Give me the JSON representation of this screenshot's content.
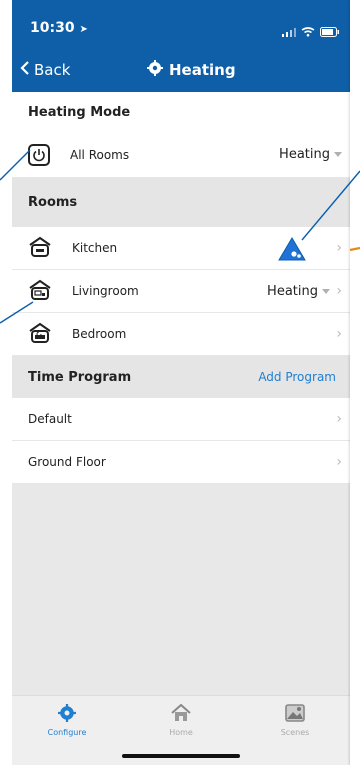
{
  "status_bar": {
    "time": "10:30"
  },
  "nav": {
    "back_label": "Back",
    "title": "Heating",
    "title_icon": "gear-icon"
  },
  "heating_mode": {
    "title": "Heating Mode",
    "row_label": "All Rooms",
    "row_value": "Heating",
    "icon": "power-icon"
  },
  "rooms": {
    "title": "Rooms",
    "items": [
      {
        "label": "Kitchen",
        "icon": "kitchen-icon",
        "value": ""
      },
      {
        "label": "Livingroom",
        "icon": "livingroom-icon",
        "value": "Heating"
      },
      {
        "label": "Bedroom",
        "icon": "bedroom-icon",
        "value": ""
      }
    ]
  },
  "time_program": {
    "title": "Time Program",
    "add_label": "Add Program",
    "items": [
      {
        "label": "Default"
      },
      {
        "label": "Ground Floor"
      }
    ]
  },
  "tabbar": {
    "items": [
      {
        "label": "Configure",
        "icon": "gear-icon",
        "active": true
      },
      {
        "label": "Home",
        "icon": "home-icon",
        "active": false
      },
      {
        "label": "Scenes",
        "icon": "image-icon",
        "active": false
      }
    ]
  },
  "colors": {
    "header": "#0e5fa8",
    "accent": "#1f7fd1",
    "warning_badge": "#1f72d6",
    "annotation_line": "#0c5fae"
  }
}
